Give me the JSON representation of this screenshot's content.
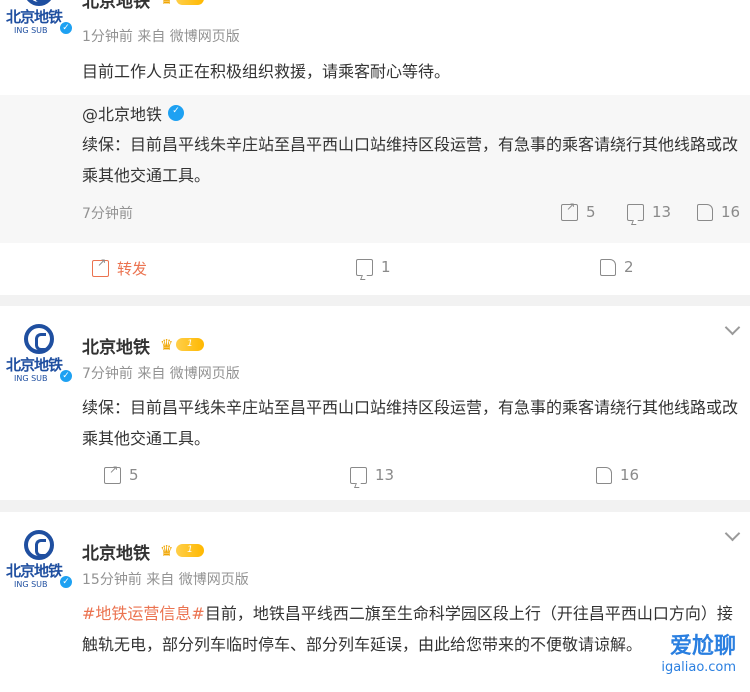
{
  "account": {
    "name": "北京地铁",
    "level": "1",
    "logo_text": "北京地铁",
    "logo_sub": "ING SUB",
    "verified_mark": "✓"
  },
  "post1": {
    "time_meta": "1分钟前  来自 微博网页版",
    "text": "目前工作人员正在积极组织救援，请乘客耐心等待。",
    "repost": {
      "author": "@北京地铁",
      "text": "续保：目前昌平线朱辛庄站至昌平西山口站维持区段运营，有急事的乘客请绕行其他线路或改乘其他交通工具。",
      "time": "7分钟前",
      "shares": "5",
      "comments": "13",
      "likes": "16"
    },
    "actions": {
      "share_label": "转发",
      "comments": "1",
      "likes": "2"
    }
  },
  "post2": {
    "time_meta": "7分钟前  来自 微博网页版",
    "text": "续保：目前昌平线朱辛庄站至昌平西山口站维持区段运营，有急事的乘客请绕行其他线路或改乘其他交通工具。",
    "actions": {
      "shares": "5",
      "comments": "13",
      "likes": "16"
    }
  },
  "post3": {
    "time_meta": "15分钟前  来自 微博网页版",
    "hashtag": "#地铁运营信息#",
    "text": "目前，地铁昌平线西二旗至生命科学园区段上行（开往昌平西山口方向）接触轨无电，部分列车临时停车、部分列车延误，由此给您带来的不便敬请谅解。"
  },
  "watermark": {
    "line1": "爱尬聊",
    "line2": "igaliao.com"
  },
  "colors": {
    "accent": "#eb7350",
    "brand": "#1f4fa0",
    "muted": "#939393"
  },
  "icons": [
    "share-icon",
    "comment-icon",
    "like-icon",
    "chevron-down-icon",
    "crown-icon",
    "verified-icon"
  ]
}
